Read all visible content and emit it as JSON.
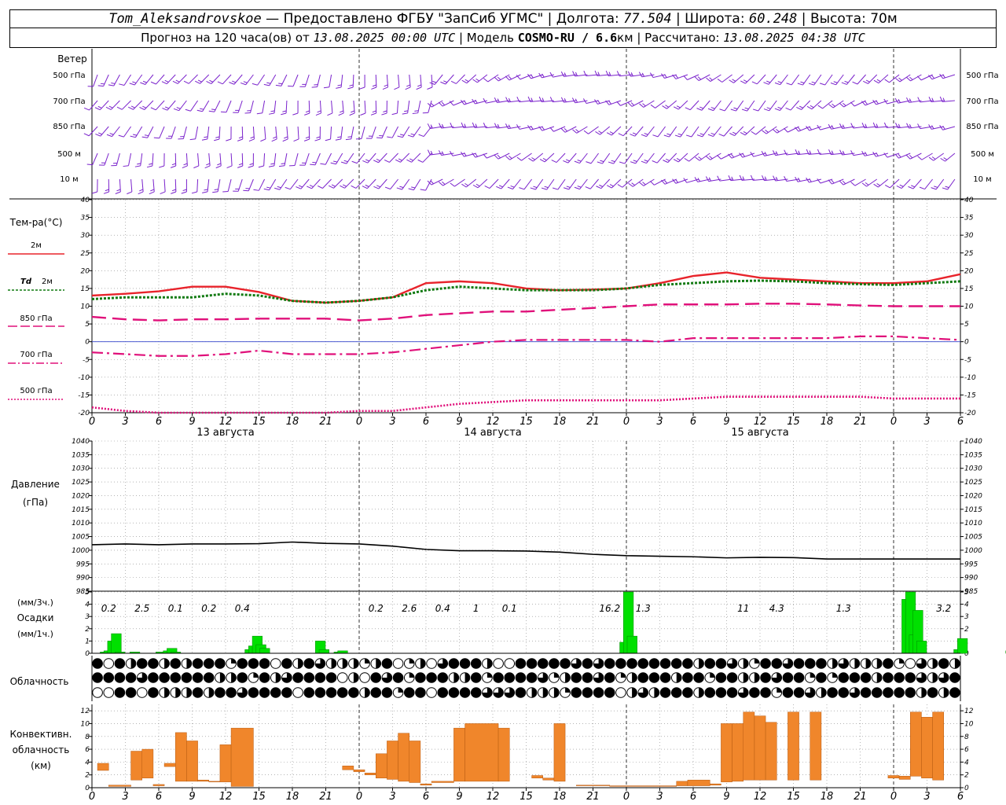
{
  "header": {
    "station": "Tom_Aleksandrovskoe",
    "provider": " — Предоставлено ФГБУ \"ЗапСиб УГМС\" | Долгота: ",
    "lon": "77.504",
    "lat_label": " | Широта: ",
    "lat": "60.248",
    "alt_label": " | Высота: 70м",
    "forecast_label": "Прогноз на 120 часа(ов) от ",
    "forecast_date": "13.08.2025 00:00 UTC",
    "model_label": "  | Модель ",
    "model": "COSMO-RU / 6.6",
    "model_unit": "км",
    "calc_label": " | Рассчитано: ",
    "calc_date": "13.08.2025 04:38 UTC"
  },
  "wind_panel": {
    "title": "Ветер",
    "levels": [
      "500 гПа",
      "700 гПа",
      "850 гПа",
      "500 м",
      "10 м"
    ]
  },
  "colors": {
    "t2m": "#e8232b",
    "td2m": "#117a11",
    "t850": "#e0107a",
    "t700": "#e0107a",
    "t500": "#e0107a",
    "wind": "#7a22cc",
    "precip": "#00e000",
    "conv": "#f0862b",
    "pressure": "#000000"
  },
  "x_hour_labels": [
    "0",
    "3",
    "6",
    "9",
    "12",
    "15",
    "18",
    "21",
    "0",
    "3",
    "6",
    "9",
    "12",
    "15",
    "18",
    "21",
    "0",
    "3",
    "6",
    "9",
    "12",
    "15",
    "18",
    "21",
    "0",
    "3",
    "6"
  ],
  "day_labels": [
    "13 августа",
    "14 августа",
    "15 августа"
  ],
  "chart_data": [
    {
      "type": "line",
      "title": "Тем-ра(°C)",
      "x_hours": [
        0,
        3,
        6,
        9,
        12,
        15,
        18,
        21,
        24,
        27,
        30,
        33,
        36,
        39,
        42,
        45,
        48,
        51,
        54,
        57,
        60,
        63,
        66,
        69,
        72,
        75,
        78
      ],
      "ylim": [
        -20,
        40
      ],
      "yticks": [
        -20,
        -15,
        -10,
        -5,
        0,
        5,
        10,
        15,
        20,
        25,
        30,
        35,
        40
      ],
      "series": [
        {
          "name": "2м",
          "values": [
            13,
            13.5,
            14.2,
            15.5,
            15.5,
            14,
            11.5,
            11,
            11.5,
            12.5,
            16.5,
            17,
            16.5,
            15,
            14.5,
            14.7,
            15,
            16.5,
            18.5,
            19.5,
            18,
            17.5,
            17,
            16.5,
            16.5,
            17,
            19
          ]
        },
        {
          "name": "Td 2м",
          "values": [
            12,
            12.5,
            12.5,
            12.5,
            13.5,
            13,
            11.5,
            11,
            11.5,
            12.5,
            14.5,
            15.5,
            15,
            14.5,
            14.5,
            14.5,
            15,
            16,
            16.5,
            17,
            17.2,
            17,
            16.5,
            16.2,
            16,
            16.5,
            17
          ]
        },
        {
          "name": "850 гПа",
          "values": [
            7,
            6.3,
            6,
            6.3,
            6.3,
            6.5,
            6.5,
            6.5,
            6,
            6.5,
            7.5,
            8,
            8.5,
            8.5,
            9,
            9.5,
            10,
            10.5,
            10.5,
            10.5,
            10.7,
            10.7,
            10.5,
            10.2,
            10,
            10,
            10
          ]
        },
        {
          "name": "700 гПа",
          "values": [
            -3,
            -3.5,
            -4,
            -4,
            -3.5,
            -2.5,
            -3.5,
            -3.5,
            -3.5,
            -3,
            -2,
            -1,
            0,
            0.5,
            0.5,
            0.5,
            0.5,
            0,
            1,
            1,
            1,
            1,
            1,
            1.5,
            1.5,
            1,
            0.5
          ]
        },
        {
          "name": "500 гПа",
          "values": [
            -18.5,
            -19.5,
            -20,
            -20,
            -20,
            -20,
            -20,
            -20,
            -19.5,
            -19.5,
            -18.5,
            -17.5,
            -17,
            -16.5,
            -16.5,
            -16.5,
            -16.5,
            -16.5,
            -16,
            -15.5,
            -15.5,
            -15.5,
            -15.5,
            -15.5,
            -16,
            -16,
            -16
          ]
        }
      ]
    },
    {
      "type": "line",
      "title": "Давление",
      "unit": "(гПа)",
      "x_hours": [
        0,
        3,
        6,
        9,
        12,
        15,
        18,
        21,
        24,
        27,
        30,
        33,
        36,
        39,
        42,
        45,
        48,
        51,
        54,
        57,
        60,
        63,
        66,
        69,
        72,
        75,
        78
      ],
      "ylim": [
        985,
        1040
      ],
      "yticks": [
        985,
        990,
        995,
        1000,
        1005,
        1010,
        1015,
        1020,
        1025,
        1030,
        1035,
        1040
      ],
      "series": [
        {
          "name": "давление",
          "values": [
            1002,
            1002.3,
            1002,
            1002.3,
            1002.3,
            1002.4,
            1003,
            1002.5,
            1002.3,
            1001.5,
            1000.3,
            999.8,
            999.8,
            999.7,
            999.3,
            998.5,
            998,
            997.8,
            997.6,
            997.2,
            997.4,
            997.3,
            996.8,
            996.8,
            996.8,
            996.8,
            996.8
          ]
        }
      ]
    },
    {
      "type": "bar",
      "title": "Осадки",
      "unit_top": "(мм/3ч.)",
      "unit_bottom": "(мм/1ч.)",
      "ylim": [
        0,
        5
      ],
      "yticks": [
        0,
        1,
        2,
        3,
        4,
        5
      ],
      "hourly_values": [
        0,
        0,
        0.1,
        0.2,
        1,
        1.6,
        0.1,
        0,
        0,
        0,
        0.1,
        0,
        0,
        0,
        0,
        0,
        0,
        0.1,
        0,
        0.2,
        0.4,
        0.1,
        0,
        0,
        0,
        0,
        0,
        0,
        0,
        0,
        0,
        0,
        0,
        0,
        0,
        0,
        0,
        0,
        0,
        0,
        0,
        0.3,
        0.6,
        1.4,
        0.7,
        0.4,
        0,
        0,
        0,
        0,
        0,
        0,
        0,
        0,
        0,
        0,
        0,
        0,
        0,
        0,
        1,
        0.3,
        0,
        0,
        0,
        0.1,
        0.2,
        0,
        0,
        0,
        0,
        0,
        0,
        0,
        0,
        0,
        0,
        0,
        0,
        0,
        0,
        0,
        0,
        0,
        0,
        0,
        0,
        0,
        0,
        0,
        0,
        0,
        0,
        0,
        0,
        0,
        0,
        0,
        0,
        0,
        0,
        0,
        0,
        0,
        0,
        0,
        0,
        0,
        0,
        0,
        0,
        0,
        0,
        0,
        0,
        0,
        0,
        0,
        0,
        0,
        0,
        0,
        0,
        0,
        0,
        0,
        0,
        0,
        0,
        0,
        0,
        0,
        0,
        0,
        0,
        0,
        0,
        0,
        0,
        0,
        0,
        0,
        0.9,
        6,
        1.4,
        0,
        0,
        0,
        0,
        0,
        0,
        0,
        0,
        0,
        0,
        0,
        0,
        0,
        0,
        0,
        0,
        0,
        0,
        0,
        0,
        0,
        0,
        0,
        0,
        0,
        0,
        0,
        0,
        0,
        0,
        0,
        0,
        0,
        0,
        0,
        0,
        0,
        0,
        0,
        0,
        0,
        0,
        0,
        0,
        0,
        0,
        0,
        0,
        0,
        0,
        0,
        0,
        0,
        0,
        0,
        0,
        0,
        0,
        0,
        0,
        0,
        0,
        0,
        0,
        0,
        0,
        0,
        0,
        0,
        0,
        0,
        0,
        0,
        4.4,
        5.1,
        1.5,
        3.5,
        1,
        0,
        0,
        0,
        0,
        0,
        0,
        0,
        0,
        0,
        0.3,
        1.2,
        0,
        0,
        0,
        0,
        0,
        0,
        0,
        0,
        0,
        0,
        0,
        0,
        0.2,
        0.3,
        2.8
      ],
      "labels_3h": [
        {
          "hour": 1.5,
          "text": "0.2"
        },
        {
          "hour": 4.5,
          "text": "2.5"
        },
        {
          "hour": 7.5,
          "text": "0.1"
        },
        {
          "hour": 10.5,
          "text": "0.2"
        },
        {
          "hour": 13.5,
          "text": "0.4"
        },
        {
          "hour": 25.5,
          "text": "0.2"
        },
        {
          "hour": 28.5,
          "text": "2.6"
        },
        {
          "hour": 31.5,
          "text": "0.4"
        },
        {
          "hour": 34.5,
          "text": "1"
        },
        {
          "hour": 37.5,
          "text": "0.1"
        },
        {
          "hour": 46.5,
          "text": "16.2"
        },
        {
          "hour": 49.5,
          "text": "1.3"
        },
        {
          "hour": 58.5,
          "text": "11"
        },
        {
          "hour": 61.5,
          "text": "4.3"
        },
        {
          "hour": 67.5,
          "text": "1.3"
        },
        {
          "hour": 76.5,
          "text": "3.2"
        }
      ]
    },
    {
      "type": "bar",
      "title": "Конвективн. облачность",
      "unit": "(км)",
      "ylim": [
        0,
        13
      ],
      "yticks": [
        0,
        2,
        4,
        6,
        8,
        10,
        12
      ],
      "bars": [
        {
          "from": 0.5,
          "to": 1.5,
          "base": 2.7,
          "top": 3.8
        },
        {
          "from": 1.5,
          "to": 3.5,
          "base": 0.2,
          "top": 0.4
        },
        {
          "from": 3.5,
          "to": 4.5,
          "base": 1.2,
          "top": 5.7
        },
        {
          "from": 4.5,
          "to": 5.5,
          "base": 1.5,
          "top": 6
        },
        {
          "from": 5.5,
          "to": 6.5,
          "base": 0.3,
          "top": 0.5
        },
        {
          "from": 6.5,
          "to": 7.5,
          "base": 3.3,
          "top": 3.8
        },
        {
          "from": 7.5,
          "to": 8.5,
          "base": 1,
          "top": 8.6
        },
        {
          "from": 8.5,
          "to": 9.5,
          "base": 1,
          "top": 7.3
        },
        {
          "from": 9.5,
          "to": 10.5,
          "base": 1,
          "top": 1.2
        },
        {
          "from": 10.5,
          "to": 11.5,
          "base": 0.9,
          "top": 1
        },
        {
          "from": 11.5,
          "to": 12.5,
          "base": 0.9,
          "top": 6.7
        },
        {
          "from": 12.5,
          "to": 14.5,
          "base": 0.2,
          "top": 9.3
        },
        {
          "from": 22.5,
          "to": 23.5,
          "base": 2.8,
          "top": 3.4
        },
        {
          "from": 23.5,
          "to": 24.5,
          "base": 2.5,
          "top": 2.8
        },
        {
          "from": 24.5,
          "to": 25.5,
          "base": 2,
          "top": 2.3
        },
        {
          "from": 25.5,
          "to": 26.5,
          "base": 1.5,
          "top": 5.3
        },
        {
          "from": 26.5,
          "to": 27.5,
          "base": 1.3,
          "top": 7.3
        },
        {
          "from": 27.5,
          "to": 28.5,
          "base": 1,
          "top": 8.5
        },
        {
          "from": 28.5,
          "to": 29.5,
          "base": 0.8,
          "top": 7.3
        },
        {
          "from": 29.5,
          "to": 30.5,
          "base": 0.4,
          "top": 0.6
        },
        {
          "from": 30.5,
          "to": 32.5,
          "base": 0.8,
          "top": 1
        },
        {
          "from": 32.5,
          "to": 33.5,
          "base": 1,
          "top": 9.3
        },
        {
          "from": 33.5,
          "to": 36.5,
          "base": 1,
          "top": 10
        },
        {
          "from": 36.5,
          "to": 37.5,
          "base": 1,
          "top": 9.3
        },
        {
          "from": 39.5,
          "to": 40.5,
          "base": 1.5,
          "top": 1.9
        },
        {
          "from": 40.5,
          "to": 41.5,
          "base": 1.2,
          "top": 1.5
        },
        {
          "from": 41.5,
          "to": 42.5,
          "base": 1,
          "top": 10
        },
        {
          "from": 43.5,
          "to": 46.5,
          "base": 0.3,
          "top": 0.4
        },
        {
          "from": 46.5,
          "to": 52.5,
          "base": 0.2,
          "top": 0.3
        },
        {
          "from": 52.5,
          "to": 53.5,
          "base": 0.3,
          "top": 1
        },
        {
          "from": 53.5,
          "to": 55.5,
          "base": 0.3,
          "top": 1.2
        },
        {
          "from": 55.5,
          "to": 56.5,
          "base": 0.4,
          "top": 0.6
        },
        {
          "from": 56.5,
          "to": 57.5,
          "base": 0.9,
          "top": 10
        },
        {
          "from": 57.5,
          "to": 58.5,
          "base": 1,
          "top": 10
        },
        {
          "from": 58.5,
          "to": 59.5,
          "base": 1.2,
          "top": 11.8
        },
        {
          "from": 59.5,
          "to": 60.5,
          "base": 1.2,
          "top": 11.2
        },
        {
          "from": 60.5,
          "to": 61.5,
          "base": 1.2,
          "top": 10.2
        },
        {
          "from": 62.5,
          "to": 63.5,
          "base": 1.2,
          "top": 11.8
        },
        {
          "from": 64.5,
          "to": 65.5,
          "base": 1.2,
          "top": 11.8
        },
        {
          "from": 71.5,
          "to": 72.5,
          "base": 1.5,
          "top": 1.9
        },
        {
          "from": 72.5,
          "to": 73.5,
          "base": 1.3,
          "top": 1.8
        },
        {
          "from": 73.5,
          "to": 74.5,
          "base": 1.8,
          "top": 11.8
        },
        {
          "from": 74.5,
          "to": 75.5,
          "base": 1.5,
          "top": 11
        },
        {
          "from": 75.5,
          "to": 76.5,
          "base": 1.2,
          "top": 11.8
        }
      ]
    }
  ],
  "panels": {
    "temperature": {
      "title": "Тем-ра(°C)",
      "legend": [
        "2м",
        "Td",
        "2м",
        "850 гПа",
        "700 гПа",
        "500 гПа"
      ]
    },
    "pressure": {
      "title": "Давление",
      "unit": "(гПа)"
    },
    "precip": {
      "unit_top": "(мм/3ч.)",
      "title": "Осадки",
      "unit_bottom": "(мм/1ч.)"
    },
    "cloud": {
      "title": "Облачность",
      "layers": 3
    },
    "convective": {
      "title": "Конвективн.",
      "title2": "облачность",
      "unit": "(км)"
    }
  }
}
